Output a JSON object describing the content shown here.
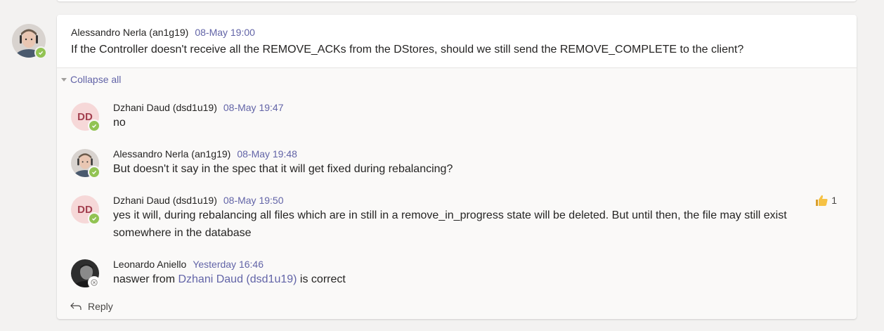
{
  "root": {
    "author": "Alessandro Nerla (an1g19)",
    "time": "08-May 19:00",
    "text": "If the Controller doesn't receive all the REMOVE_ACKs from the DStores, should we still send the REMOVE_COMPLETE to the client?"
  },
  "collapse_label": "Collapse all",
  "replies": [
    {
      "author": "Dzhani Daud (dsd1u19)",
      "time": "08-May 19:47",
      "text": "no",
      "initials": "DD"
    },
    {
      "author": "Alessandro Nerla (an1g19)",
      "time": "08-May 19:48",
      "text": "But doesn't it say in the spec that it will get fixed during rebalancing?"
    },
    {
      "author": "Dzhani Daud (dsd1u19)",
      "time": "08-May 19:50",
      "text": "yes it will, during rebalancing all files which are in still in a remove_in_progress state will be deleted. But until then, the file may still exist somewhere in the database",
      "initials": "DD",
      "reaction_count": "1"
    },
    {
      "author": "Leonardo Aniello",
      "time": "Yesterday 16:46",
      "text_before": "naswer from ",
      "mention": "Dzhani Daud (dsd1u19)",
      "text_after": " is correct"
    }
  ],
  "reply_label": "Reply",
  "colors": {
    "accent": "#6264a7",
    "presence_available": "#92c353",
    "initials_bg": "#f6d8d8",
    "initials_fg": "#a3404f"
  },
  "icons": [
    "check-icon",
    "thumbs-up-icon",
    "reply-arrow-icon",
    "collapse-triangle-icon",
    "away-x-icon"
  ]
}
